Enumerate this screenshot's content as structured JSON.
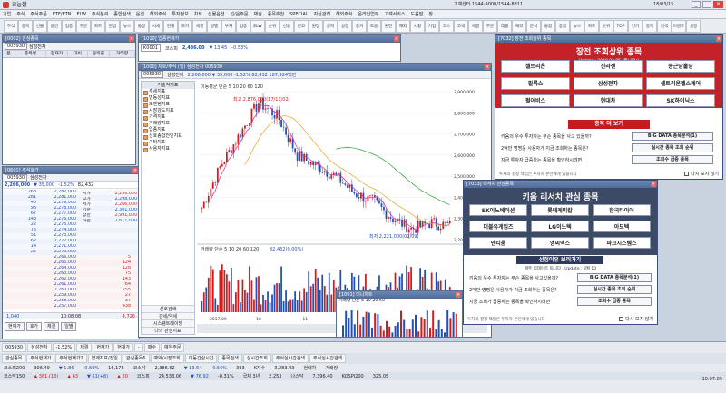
{
  "app": {
    "title": "오늘잡",
    "clock": "10:07:09",
    "login_info": "고객센터 1544-9000/1544-8811",
    "date": "18/03/15"
  },
  "menu": [
    "기업",
    "주식",
    "주식주문",
    "ETF/ETN",
    "ELW",
    "주식분석",
    "종합검색",
    "옵션",
    "해외주식",
    "투자정보",
    "차트",
    "선물옵션",
    "선/옵주문",
    "채권",
    "종목추천",
    "SPECIAL",
    "자산관리",
    "해외주식",
    "온라인업무",
    "고객서비스",
    "도움말",
    "창"
  ],
  "toolbar": [
    "주식",
    "종목",
    "선물",
    "옵션",
    "업종",
    "주문",
    "차트",
    "관심",
    "뉴스",
    "통장",
    "시세",
    "현재",
    "호가",
    "체결",
    "일별",
    "투자",
    "업종",
    "ELW",
    "순위",
    "신용",
    "잔고",
    "원장",
    "공지",
    "설정",
    "증거",
    "도움",
    "환전",
    "해외",
    "시황",
    "기업",
    "코스",
    "코넥",
    "체결",
    "주문",
    "레벨",
    "예약",
    "분석",
    "통합",
    "종합",
    "뉴스",
    "차트",
    "순위",
    "TOP",
    "인기",
    "종목",
    "검색",
    "이벤트",
    "설정"
  ],
  "win_quote": {
    "title": "[0002] 관심종목",
    "code": "005930",
    "name": "삼성전자",
    "headers": [
      "분",
      "종목명",
      "현재가",
      "대비",
      "등락률",
      "거래량"
    ]
  },
  "win_hoga": {
    "title": "[0601] 주식호가",
    "code": "005930",
    "name": "삼성전자",
    "price": "2,266,000",
    "change": "▼ 35,000",
    "rate": "-1.52%",
    "volume": "82,432",
    "asks": [
      {
        "qty": "268",
        "price": "2,282,000"
      },
      {
        "qty": "281",
        "price": "2,281,000"
      },
      {
        "qty": "40",
        "price": "2,279,000"
      },
      {
        "qty": "96",
        "price": "2,278,000"
      },
      {
        "qty": "67",
        "price": "2,277,000"
      },
      {
        "qty": "143",
        "price": "2,276,000"
      },
      {
        "qty": "22",
        "price": "2,275,000"
      },
      {
        "qty": "76",
        "price": "2,274,000"
      },
      {
        "qty": "51",
        "price": "2,273,000"
      },
      {
        "qty": "62",
        "price": "2,272,000"
      },
      {
        "qty": "14",
        "price": "2,271,000"
      },
      {
        "qty": "25",
        "price": "2,270,000"
      }
    ],
    "bids": [
      {
        "price": "2,266,000",
        "qty": "5"
      },
      {
        "price": "2,265,000",
        "qty": "124"
      },
      {
        "price": "2,264,000",
        "qty": "128"
      },
      {
        "price": "2,263,000",
        "qty": "75"
      },
      {
        "price": "2,262,000",
        "qty": "143"
      },
      {
        "price": "2,261,000",
        "qty": "64"
      },
      {
        "price": "2,260,000",
        "qty": "255"
      },
      {
        "price": "2,259,000",
        "qty": "27"
      },
      {
        "price": "2,258,000",
        "qty": "37"
      },
      {
        "price": "2,257,000",
        "qty": "438"
      }
    ],
    "side_labels": [
      "시가",
      "고가",
      "저가",
      "기준",
      "상한",
      "하한"
    ],
    "side_values": [
      "2,296,000",
      "2,298,000",
      "2,266,000",
      "2,301,000",
      "2,991,000",
      "1,611,000"
    ],
    "total_ask": "1,040",
    "total_bid": "4,726",
    "time": "10:08:08",
    "buttons": [
      "현재가",
      "호가",
      "체결",
      "일별"
    ]
  },
  "win_sector": {
    "title": "[1010] 업종현재가",
    "code": "K0001",
    "name": "코스피",
    "index": "2,486.00",
    "change": "▼ 13.45",
    "rate": "-0.53%"
  },
  "win_chart": {
    "title": "[1000] 차트/주식 (일) 삼성전자 005930",
    "code": "005930",
    "name": "삼성전자",
    "price_info": "2,266,000  ▼ 35,000  -1.52%  82,432  187,924백만",
    "ma_legend": "이동평균 단순 5 10 20 60 120",
    "high_label": "최고 2,876,000(17/11/02)",
    "low_label": "최저 2,221,000(02/09)",
    "vol_legend": "거래량 단순 5 10 20 60 120",
    "vol_value": "82,432(0.00%)",
    "x_labels": [
      "2017/09",
      "10",
      "11",
      "12",
      "2018/01",
      "02"
    ],
    "y_labels": [
      "2,900,000",
      "2,800,000",
      "2,700,000",
      "2,600,000",
      "2,500,000",
      "2,400,000",
      "2,300,000",
      "2,200,000"
    ],
    "indicator_title": "기술적지표",
    "indicators": [
      "추세지표",
      "변동성지표",
      "모멘텀지표",
      "시장강도지표",
      "가격지표",
      "거래량지표",
      "업종지표",
      "신호종합전인지표",
      "기타지표",
      "사용자지표"
    ],
    "indicator_footer": [
      "신호검색",
      "강세/약세",
      "시스템트레이딩",
      "나의 관심지표"
    ],
    "tabs": [
      "주식",
      "업종",
      "선물",
      "옵션",
      "해외"
    ]
  },
  "win_small_chart": {
    "title": "[1001] 미니차트",
    "legend": "거래량 단순 5 10 20 60",
    "value": "35,000 ▼"
  },
  "popup_top": {
    "title": "[7032] 장전 조회상위 종목",
    "header": "장전 조회상위 종목",
    "update": "Update : 2018.03.05 (월) 08시",
    "stocks": [
      "셀트리온",
      "신라젠",
      "종근당홀딩",
      "필룩스",
      "삼성전자",
      "셀트리온헬스케어",
      "펄어비스",
      "현대차",
      "SK하이닉스"
    ],
    "more_label": "종목 더 보기",
    "questions": [
      "키움의 우수 투자자는 무슨 종목을 사고 있을까?",
      "2억만 명명운 사용자가 지금 조회하는 종목은?",
      "지금 투자자 급증하는 종목을 확인하시려면"
    ],
    "q_buttons": [
      "BIG DATA 종목분석(1)",
      "실시간 종목 조회 순위",
      "조회수 급증 종목"
    ],
    "footer": "투자의 결정 책임은 투자자 본인에게 있습니다",
    "no_show": "다시 보지 않기"
  },
  "popup_bottom": {
    "title": "[7033] 리서치 관심종목",
    "header": "키움 리서치 관심 종목",
    "stocks": [
      "SK이노베이션",
      "롯데케미칼",
      "한국타이어",
      "더블유게임즈",
      "LG이노텍",
      "아모텍",
      "덴티움",
      "엠씨넥스",
      "파크시스템스"
    ],
    "more_label": "선정이유 보러가기",
    "update": "매주 업데이트 됩니다 .  Update : 3월 10",
    "questions": [
      "키움의 우수 투자자는 무슨 종목을 사고있을까?",
      "2억만 명명운 사용자가 지금 조회하는 종목은?",
      "지금 조회가 급증하는 종목을 확인하시려면"
    ],
    "q_buttons": [
      "BIG DATA 종목분석(1)",
      "실시간 종목 조회 순위",
      "조회수 급증 종목"
    ],
    "footer": "투자의 결정 책임은 투자자 본인에게 있습니다",
    "no_show": "다시 보지 않기"
  },
  "bottom_bar": {
    "code_row": [
      "005930",
      "삼성전자",
      "-1.52%",
      "체결",
      "현재가",
      "현재가",
      "-",
      "매수",
      "예약주문"
    ],
    "tabs": [
      "관심종목",
      "주식현재가",
      "주식현재가2",
      "연계지표/전일",
      "관심종목6",
      "예약/시장조회",
      "이동간실시간",
      "종목검색",
      "실시간조회",
      "주식실시간검색",
      "주식실시간검색"
    ],
    "ticker1": [
      "코스피200",
      "306.49",
      "▼ 1.86",
      "-0.60%",
      "16,175",
      "코스닥",
      "2,386.62",
      "▼ 13.54",
      "-0.56%",
      "393",
      "K지수",
      "3,283.43",
      "현대차",
      "거래량"
    ],
    "ticker2": [
      "코스닥150",
      "▲ 361.(13)",
      "▲ 63",
      "▼ 61(+8)",
      "▲ 20",
      "코스피",
      "24,538.06",
      "▼ 76.92",
      "-0.31%",
      "국채 3년",
      "2.253",
      "나스닥",
      "7,396.40",
      "KOSPI200",
      "325.05"
    ]
  },
  "colors": {
    "up": "#d01c1c",
    "down": "#1f4fb8",
    "title_bar": "#4f6b98",
    "popup_border": "#3b4f7a",
    "cta": "#c41c1c"
  }
}
